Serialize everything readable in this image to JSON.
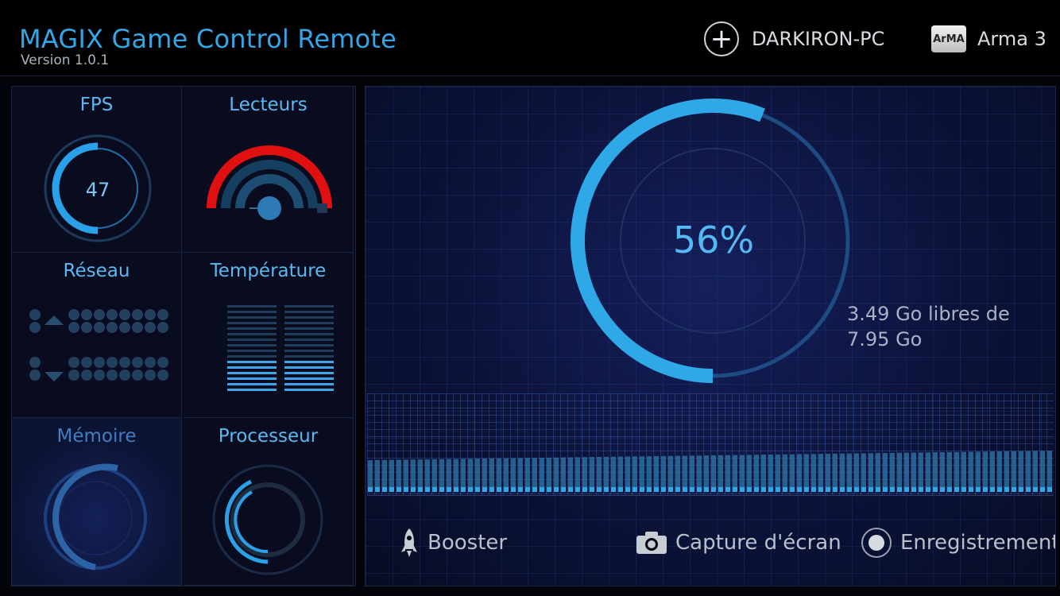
{
  "header": {
    "title": "MAGIX Game Control Remote",
    "version": "Version 1.0.1",
    "pc_name": "DARKIRON-PC",
    "game_name": "Arma 3",
    "game_icon_text": "ArMA"
  },
  "tiles": {
    "fps": {
      "label": "FPS",
      "value": "47"
    },
    "drives": {
      "label": "Lecteurs"
    },
    "network": {
      "label": "Réseau"
    },
    "temperature": {
      "label": "Température"
    },
    "memory": {
      "label": "Mémoire"
    },
    "cpu": {
      "label": "Processeur"
    }
  },
  "main": {
    "usage_percent_text": "56%",
    "usage_fraction": 0.56,
    "free_text": "3.49 Go libres de 7.95 Go"
  },
  "actions": {
    "booster": "Booster",
    "screenshot": "Capture d'écran",
    "record": "Enregistrement"
  },
  "colors": {
    "accent": "#2fa3e6",
    "alert_red": "#e01010",
    "panel_dark": "#0b1238"
  }
}
